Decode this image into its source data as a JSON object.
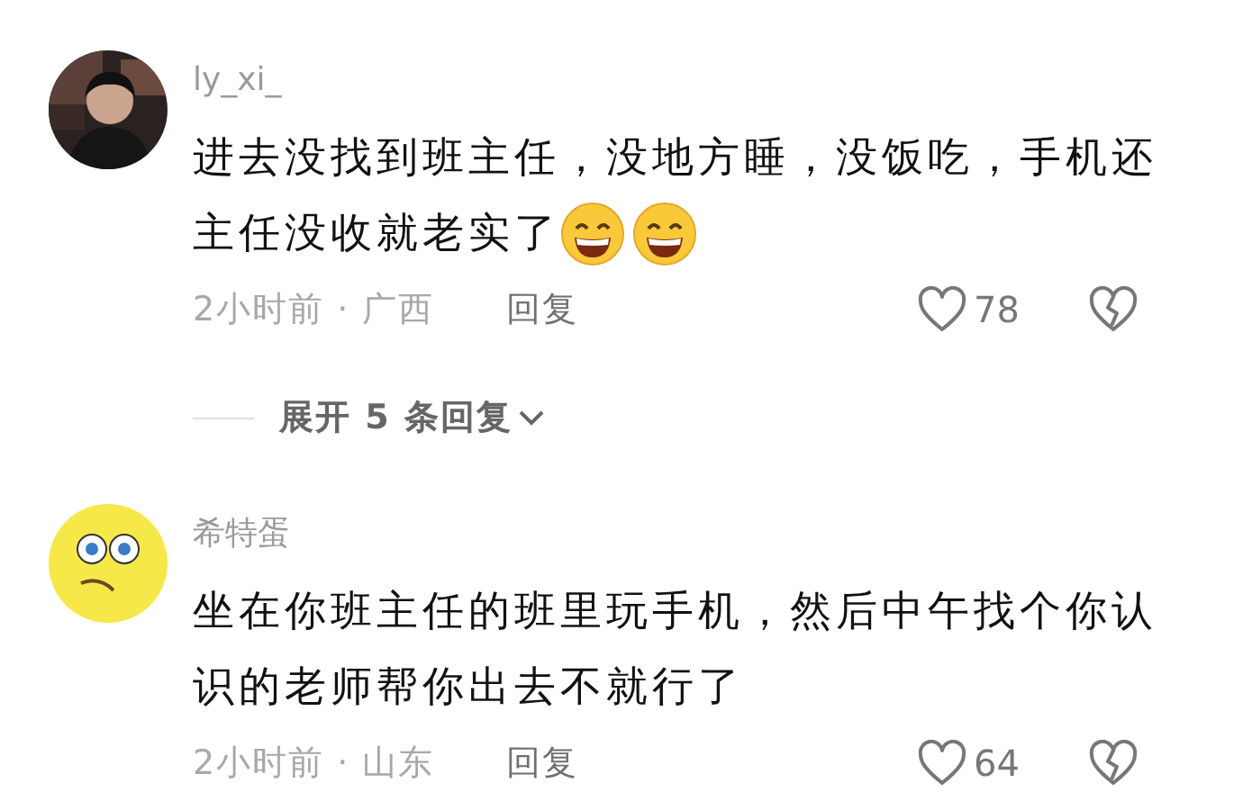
{
  "comments": [
    {
      "username": "ly_xi_",
      "lines": [
        "进去没找到班主任，没地方睡，没饭吃，手机还",
        "主任没收就老实了"
      ],
      "emojis": [
        {
          "kind": "grin"
        },
        {
          "kind": "grin"
        }
      ],
      "meta": "2小时前 · 广西",
      "reply": "回复",
      "likes": "78",
      "expand_replies": "展开 5 条回复"
    },
    {
      "avatar": {
        "kind": "cartoon"
      },
      "username": "希特蛋",
      "lines": [
        "坐在你班主任的班里玩手机，然后中午找个你认",
        "识的老师帮你出去不就行了"
      ],
      "meta": "2小时前 · 山东",
      "reply": "回复",
      "likes": "64"
    }
  ]
}
